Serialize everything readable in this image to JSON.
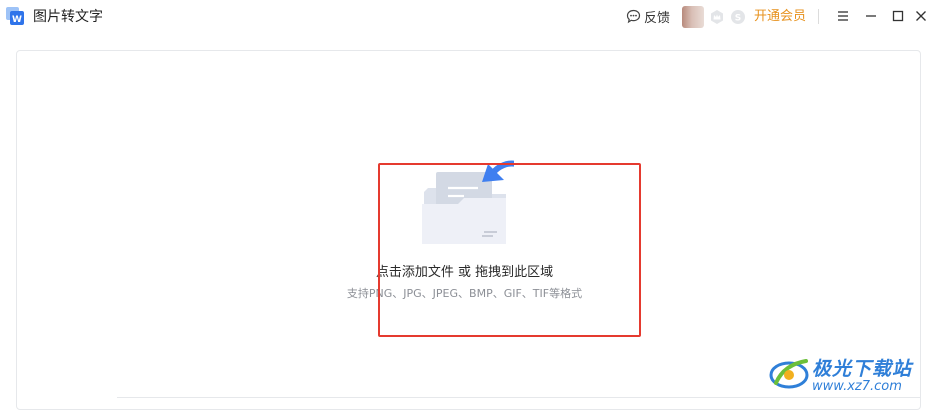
{
  "app": {
    "title": "图片转文字",
    "icon": "wps-word-icon"
  },
  "header": {
    "feedback_label": "反馈",
    "vip_label": "开通会员",
    "badges": [
      "vip-crown-badge",
      "super-member-badge"
    ]
  },
  "window_controls": [
    "menu-icon",
    "minimize-icon",
    "maximize-icon",
    "close-icon"
  ],
  "drop_zone": {
    "title": "点击添加文件 或 拖拽到此区域",
    "hint": "支持PNG、JPG、JPEG、BMP、GIF、TIF等格式",
    "icon": "folder-upload-icon"
  },
  "annotation": {
    "color": "#e53a2f"
  },
  "watermark": {
    "name": "极光下载站",
    "url": "www.xz7.com"
  },
  "colors": {
    "accent_vip": "#e7921e",
    "arrow_blue": "#3f7ff0",
    "watermark_blue": "#2f7fd8"
  }
}
